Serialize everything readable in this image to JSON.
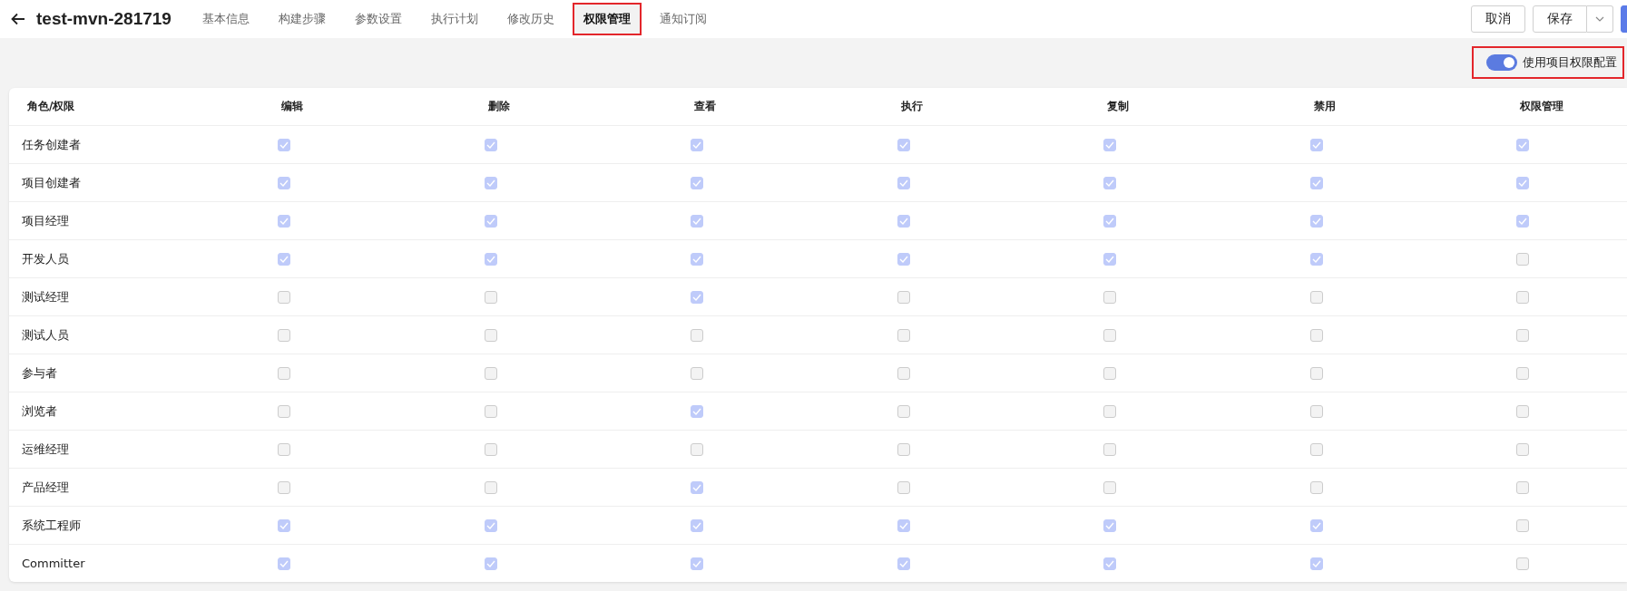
{
  "header": {
    "title": "test-mvn-281719",
    "tabs": [
      {
        "label": "基本信息",
        "selected": false,
        "highlighted": false
      },
      {
        "label": "构建步骤",
        "selected": false,
        "highlighted": false
      },
      {
        "label": "参数设置",
        "selected": false,
        "highlighted": false
      },
      {
        "label": "执行计划",
        "selected": false,
        "highlighted": false
      },
      {
        "label": "修改历史",
        "selected": false,
        "highlighted": false
      },
      {
        "label": "权限管理",
        "selected": true,
        "highlighted": true
      },
      {
        "label": "通知订阅",
        "selected": false,
        "highlighted": false
      }
    ],
    "buttons": [
      {
        "label": "取消",
        "kind": "plain"
      },
      {
        "label": "保存",
        "kind": "split"
      },
      {
        "kind": "primary"
      }
    ]
  },
  "project_permission_toggle": {
    "label": "使用项目权限配置",
    "on": true,
    "highlighted": true
  },
  "table": {
    "columns": [
      "角色/权限",
      "编辑",
      "删除",
      "查看",
      "执行",
      "复制",
      "禁用",
      "权限管理"
    ],
    "rows": [
      {
        "role": "任务创建者",
        "disabled": true,
        "checks": [
          true,
          true,
          true,
          true,
          true,
          true,
          true
        ]
      },
      {
        "role": "项目创建者",
        "disabled": true,
        "checks": [
          true,
          true,
          true,
          true,
          true,
          true,
          true
        ]
      },
      {
        "role": "项目经理",
        "disabled": true,
        "checks": [
          true,
          true,
          true,
          true,
          true,
          true,
          true
        ]
      },
      {
        "role": "开发人员",
        "disabled": true,
        "checks": [
          true,
          true,
          true,
          true,
          true,
          true,
          false
        ]
      },
      {
        "role": "测试经理",
        "disabled": true,
        "checks": [
          false,
          false,
          true,
          false,
          false,
          false,
          false
        ]
      },
      {
        "role": "测试人员",
        "disabled": true,
        "checks": [
          false,
          false,
          false,
          false,
          false,
          false,
          false
        ]
      },
      {
        "role": "参与者",
        "disabled": true,
        "checks": [
          false,
          false,
          false,
          false,
          false,
          false,
          false
        ]
      },
      {
        "role": "浏览者",
        "disabled": true,
        "checks": [
          false,
          false,
          true,
          false,
          false,
          false,
          false
        ]
      },
      {
        "role": "运维经理",
        "disabled": true,
        "checks": [
          false,
          false,
          false,
          false,
          false,
          false,
          false
        ]
      },
      {
        "role": "产品经理",
        "disabled": true,
        "checks": [
          false,
          false,
          true,
          false,
          false,
          false,
          false
        ]
      },
      {
        "role": "系统工程师",
        "disabled": true,
        "checks": [
          true,
          true,
          true,
          true,
          true,
          true,
          false
        ]
      },
      {
        "role": "Committer",
        "disabled": true,
        "checks": [
          true,
          true,
          true,
          true,
          true,
          true,
          false
        ]
      }
    ]
  }
}
